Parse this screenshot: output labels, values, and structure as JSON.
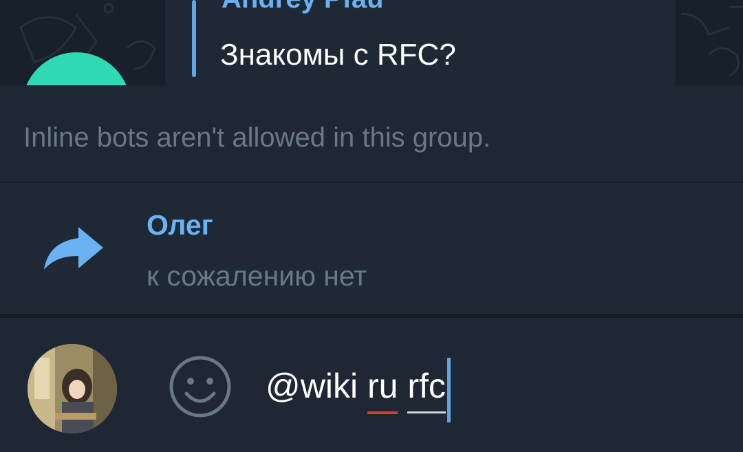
{
  "quoted_message": {
    "author": "Andrey Pfau",
    "text": "Знакомы с RFC?"
  },
  "inline_notice": {
    "text": "Inline bots aren't allowed in this group."
  },
  "forward_preview": {
    "icon": "forward-arrow-icon",
    "name": "Олег",
    "text": "к сожалению нет"
  },
  "composer": {
    "avatar": "user-avatar",
    "emoji_icon": "smiley-icon",
    "mention": "@wiki",
    "word_misspelled": "ru",
    "word_current": "rfc"
  },
  "colors": {
    "accent": "#6ab2f2",
    "background": "#1e2733",
    "muted_text": "#6a7886",
    "caret": "#5ea6e6",
    "spellcheck_underline": "#e53935"
  }
}
